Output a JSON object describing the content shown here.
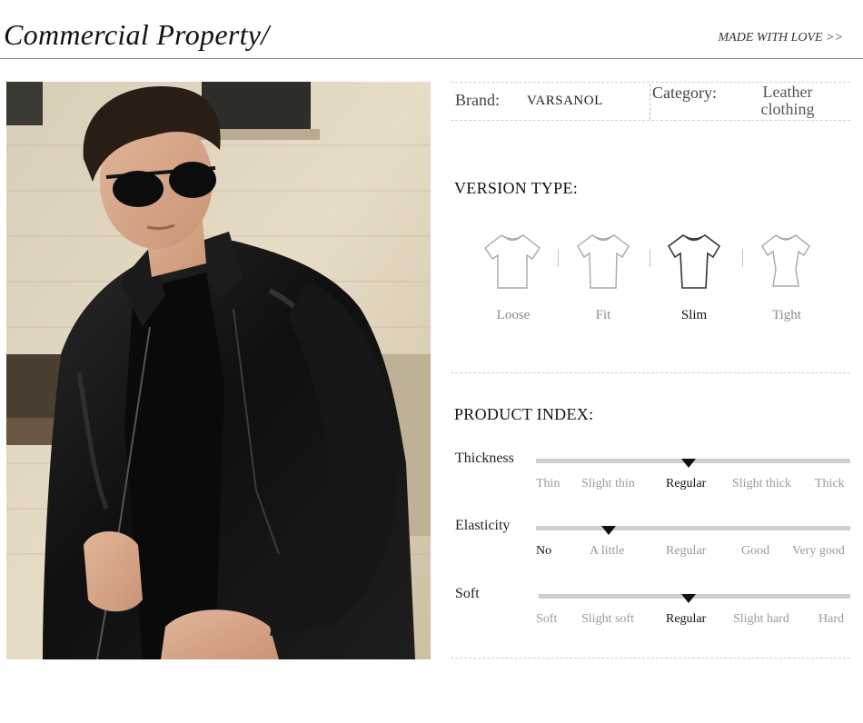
{
  "header": {
    "title": "Commercial Property/",
    "tagline": "MADE WITH LOVE >>"
  },
  "info": {
    "brand_label": "Brand:",
    "brand_value": "VARSANOL",
    "category_label": "Category:",
    "category_value_line1": "Leather",
    "category_value_line2": "clothing"
  },
  "version": {
    "title": "VERSION TYPE:",
    "options": [
      "Loose",
      "Fit",
      "Slim",
      "Tight"
    ],
    "selected": "Slim"
  },
  "product_index": {
    "title": "PRODUCT INDEX:",
    "rows": [
      {
        "label": "Thickness",
        "options": [
          "Thin",
          "Slight thin",
          "Regular",
          "Slight thick",
          "Thick"
        ],
        "selected": "Regular"
      },
      {
        "label": "Elasticity",
        "options": [
          "No",
          "A little",
          "Regular",
          "Good",
          "Very good"
        ],
        "selected": "A little"
      },
      {
        "label": "Soft",
        "options": [
          "Soft",
          "Slight soft",
          "Regular",
          "Slight hard",
          "Hard"
        ],
        "selected": "Regular"
      }
    ]
  },
  "colors": {
    "accent": "#111111",
    "muted": "#9a9a9a",
    "bar": "#cfcfcf"
  },
  "icons": [
    "loose-shirt-icon",
    "fit-shirt-icon",
    "slim-shirt-icon",
    "tight-shirt-icon",
    "indicator-triangle-icon"
  ]
}
